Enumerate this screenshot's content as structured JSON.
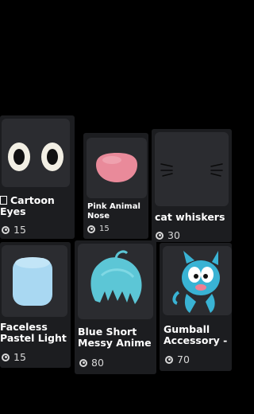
{
  "items": [
    {
      "name_line1": "Cartoon",
      "name_line2": "Eyes",
      "price": "15",
      "thumb_icon": "cartoon-eyes"
    },
    {
      "name_line1": "Pink Animal",
      "name_line2": "Nose",
      "price": "15",
      "thumb_icon": "pink-nose"
    },
    {
      "name_line1": "cat whiskers",
      "name_line2": "",
      "price": "30",
      "thumb_icon": "cat-whiskers"
    },
    {
      "name_line1": "Faceless",
      "name_line2": "Pastel Light",
      "price": "15",
      "thumb_icon": "pastel-head"
    },
    {
      "name_line1": "Blue Short",
      "name_line2": "Messy Anime",
      "price": "80",
      "thumb_icon": "blue-hair"
    },
    {
      "name_line1": "Gumball",
      "name_line2": "Accessory -",
      "price": "70",
      "thumb_icon": "gumball-accessory"
    }
  ],
  "colors": {
    "background": "#000000",
    "card": "#1c1d20",
    "thumb": "#2b2c30",
    "nose": "#e98a9a",
    "pastel": "#a9d8f2",
    "hair": "#5cc6d6",
    "gumball": "#39b3d4"
  }
}
